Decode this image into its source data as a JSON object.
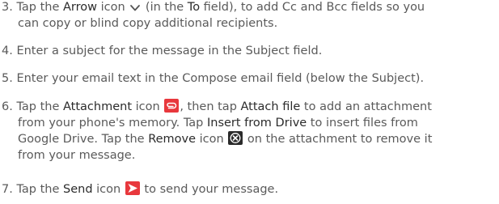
{
  "steps": [
    {
      "num": "3.",
      "l1a": "Tap the ",
      "l1b": "Arrow",
      "l1c": " icon ",
      "l1d": " (in the ",
      "l1e": "To",
      "l1f": " field), to add Cc and Bcc fields so you",
      "l2": "can copy or blind copy additional recipients."
    },
    {
      "num": "4.",
      "l1": "Enter a subject for the message in the Subject field."
    },
    {
      "num": "5.",
      "l1": "Enter your email text in the Compose email field (below the Subject)."
    },
    {
      "num": "6.",
      "l1a": "Tap the ",
      "l1b": "Attachment",
      "l1c": " icon ",
      "l1d": ", then tap ",
      "l1e": "Attach file",
      "l1f": " to add an attachment",
      "l2a": "from your phone's memory. Tap ",
      "l2b": "Insert from Drive",
      "l2c": " to insert files from",
      "l3a": "Google Drive. Tap the ",
      "l3b": "Remove",
      "l3c": " icon ",
      "l3d": " on the attachment to remove it",
      "l4": "from your message."
    },
    {
      "num": "7.",
      "l1a": "Tap the ",
      "l1b": "Send",
      "l1c": " icon ",
      "l1d": " to send your message."
    }
  ],
  "icons": {
    "arrow": "chevron-down-icon",
    "attachment": "paperclip-icon",
    "remove": "remove-x-icon",
    "send": "send-icon"
  },
  "colors": {
    "body_text": "#5a5a5a",
    "emphasis_text": "#2b2b2b",
    "attachment_icon": "#e8383d",
    "send_icon": "#e8383d",
    "remove_icon": "#2b2b2b"
  }
}
